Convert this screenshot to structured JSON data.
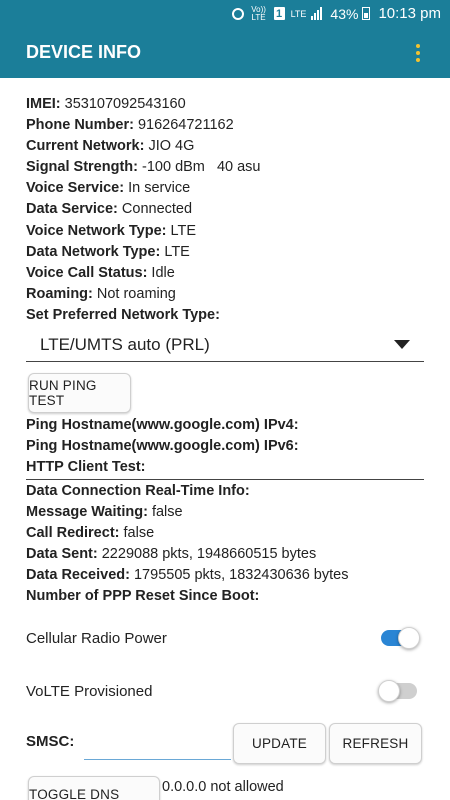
{
  "status_bar": {
    "network_label": "Vo)) LTE",
    "sim_label": "1",
    "lte_label": "LTE",
    "battery_percent": "43%",
    "time": "10:13 pm"
  },
  "app_bar": {
    "title": "DEVICE INFO",
    "menu_icon": "overflow-menu-icon"
  },
  "info_rows": [
    {
      "label": "IMEI:",
      "value": " 353107092543160"
    },
    {
      "label": "Phone Number:",
      "value": " 916264721162"
    },
    {
      "label": "Current Network:",
      "value": " JIO 4G"
    },
    {
      "label": "Signal Strength:",
      "value": " -100 dBm   40 asu"
    },
    {
      "label": "Voice Service:",
      "value": " In service"
    },
    {
      "label": "Data Service:",
      "value": " Connected"
    },
    {
      "label": "Voice Network Type:",
      "value": " LTE"
    },
    {
      "label": "Data Network Type:",
      "value": " LTE"
    },
    {
      "label": "Voice Call Status:",
      "value": " Idle"
    },
    {
      "label": "Roaming:",
      "value": " Not roaming"
    },
    {
      "label": "Set Preferred Network Type:",
      "value": ""
    }
  ],
  "preferred_network": {
    "selected": "LTE/UMTS auto (PRL)"
  },
  "ping": {
    "button_label": "RUN PING TEST",
    "rows": [
      {
        "label": "Ping Hostname(www.google.com) IPv4:",
        "value": ""
      },
      {
        "label": "Ping Hostname(www.google.com) IPv6:",
        "value": ""
      },
      {
        "label": "HTTP Client Test:",
        "value": ""
      }
    ]
  },
  "realtime_rows": [
    {
      "label": "Data Connection Real-Time Info:",
      "value": ""
    },
    {
      "label": "Message Waiting:",
      "value": " false"
    },
    {
      "label": "Call Redirect:",
      "value": " false"
    },
    {
      "label": "Data Sent:",
      "value": " 2229088 pkts, 1948660515 bytes"
    },
    {
      "label": "Data Received:",
      "value": " 1795505 pkts, 1832430636 bytes"
    },
    {
      "label": "Number of PPP Reset Since Boot:",
      "value": ""
    }
  ],
  "toggles": {
    "cellular_radio_power": {
      "label": "Cellular Radio Power",
      "on": true
    },
    "volte_provisioned": {
      "label": "VoLTE Provisioned",
      "on": false
    }
  },
  "smsc": {
    "label": "SMSC:",
    "value": "",
    "update_label": "UPDATE",
    "refresh_label": "REFRESH"
  },
  "dns": {
    "button_label": "TOGGLE DNS CHECK",
    "status": "0.0.0.0 not allowed"
  },
  "colors": {
    "app_bar": "#1b7e99",
    "accent_toggle": "#2a85d4",
    "menu_dots": "#f2c230"
  }
}
